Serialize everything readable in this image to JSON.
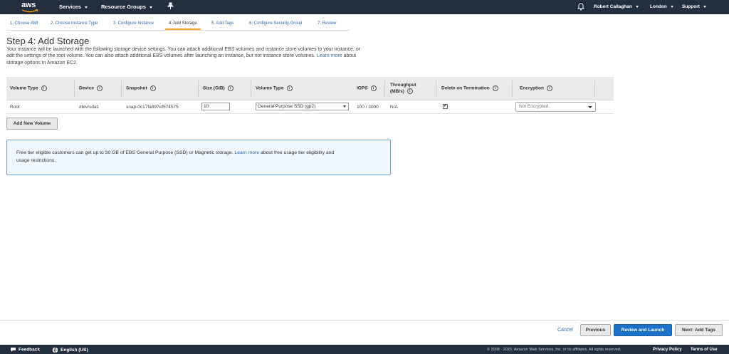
{
  "topnav": {
    "logo_text": "aws",
    "services": "Services",
    "resource_groups": "Resource Groups",
    "user": "Robert Callaghan",
    "region": "London",
    "support": "Support"
  },
  "wizard": {
    "steps": [
      {
        "label": "1. Choose AMI"
      },
      {
        "label": "2. Choose Instance Type"
      },
      {
        "label": "3. Configure Instance"
      },
      {
        "label": "4. Add Storage"
      },
      {
        "label": "5. Add Tags"
      },
      {
        "label": "6. Configure Security Group"
      },
      {
        "label": "7. Review"
      }
    ]
  },
  "page": {
    "title": "Step 4: Add Storage",
    "intro_line1": "Your instance will be launched with the following storage device settings. You can attach additional EBS volumes and instance store volumes to your instance, or",
    "intro_line2": "edit the settings of the root volume. You can also attach additional EBS volumes after launching an instance, but not instance store volumes.",
    "intro_link": "Learn more",
    "intro_after_link": "about",
    "intro_line3": "storage options in Amazon EC2."
  },
  "table": {
    "headers": {
      "volume_type": "Volume Type",
      "device": "Device",
      "snapshot": "Snapshot",
      "size": "Size (GiB)",
      "volume_type2": "Volume Type",
      "iops": "IOPS",
      "throughput1": "Throughput",
      "throughput2": "(MB/s)",
      "delete_on_termination": "Delete on Termination",
      "encryption": "Encryption"
    },
    "info_glyph": "i",
    "row": {
      "volume_type": "Root",
      "device": "/dev/sda1",
      "snapshot": "snap-0c17fa897ef574575",
      "size": "10",
      "volume_type_select": "General Purpose SSD (gp2)",
      "iops": "100 / 3000",
      "throughput": "N/A",
      "delete_on_termination_mark": "✔",
      "encryption": "Not Encrypted"
    }
  },
  "add_volume_button": "Add New Volume",
  "notice": {
    "text1": "Free tier eligible customers can get up to 30 GB of EBS General Purpose (SSD) or Magnetic storage.",
    "link": "Learn more",
    "text2": "about free usage tier eligibility and",
    "text3": "usage restrictions."
  },
  "actions": {
    "cancel": "Cancel",
    "previous": "Previous",
    "review_launch": "Review and Launch",
    "next": "Next: Add Tags"
  },
  "footer": {
    "feedback": "Feedback",
    "language": "English (US)",
    "copyright": "© 2008 - 2020, Amazon Web Services, Inc. or its affiliates. All rights reserved.",
    "privacy": "Privacy Policy",
    "terms": "Terms of Use"
  },
  "colors": {
    "nav_bg": "#232f3e",
    "link": "#2b6cb0",
    "primary_button": "#1a73c8",
    "active_step_underline": "#f0a020",
    "notice_border": "#6fa8dc"
  }
}
